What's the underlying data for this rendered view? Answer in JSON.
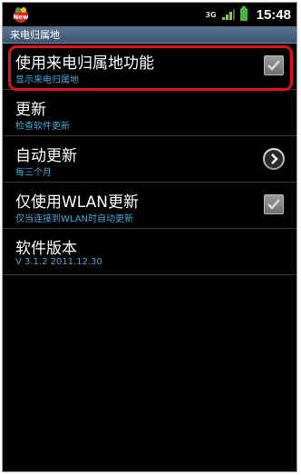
{
  "status_bar": {
    "app_badge": "New",
    "network": "3G",
    "time": "15:48",
    "battery_color": "#45b83a"
  },
  "title_bar": {
    "title": "来电归属地"
  },
  "settings": [
    {
      "title": "使用来电归属地功能",
      "subtitle": "显示来电归属地",
      "control": "checkbox",
      "checked": true,
      "highlighted": true
    },
    {
      "title": "更新",
      "subtitle": "检查软件更新",
      "control": "none"
    },
    {
      "title": "自动更新",
      "subtitle": "每三个月",
      "control": "chevron-right-icon"
    },
    {
      "title": "仅使用WLAN更新",
      "subtitle": "仅当连接到WLAN时自动更新",
      "control": "checkbox",
      "checked": true
    },
    {
      "title": "软件版本",
      "subtitle": "V 3.1.2 2011.12.30",
      "control": "none"
    }
  ],
  "colors": {
    "subtitle": "#4aa9d8",
    "highlight": "#e01020",
    "titlebar": "#4a6380"
  }
}
